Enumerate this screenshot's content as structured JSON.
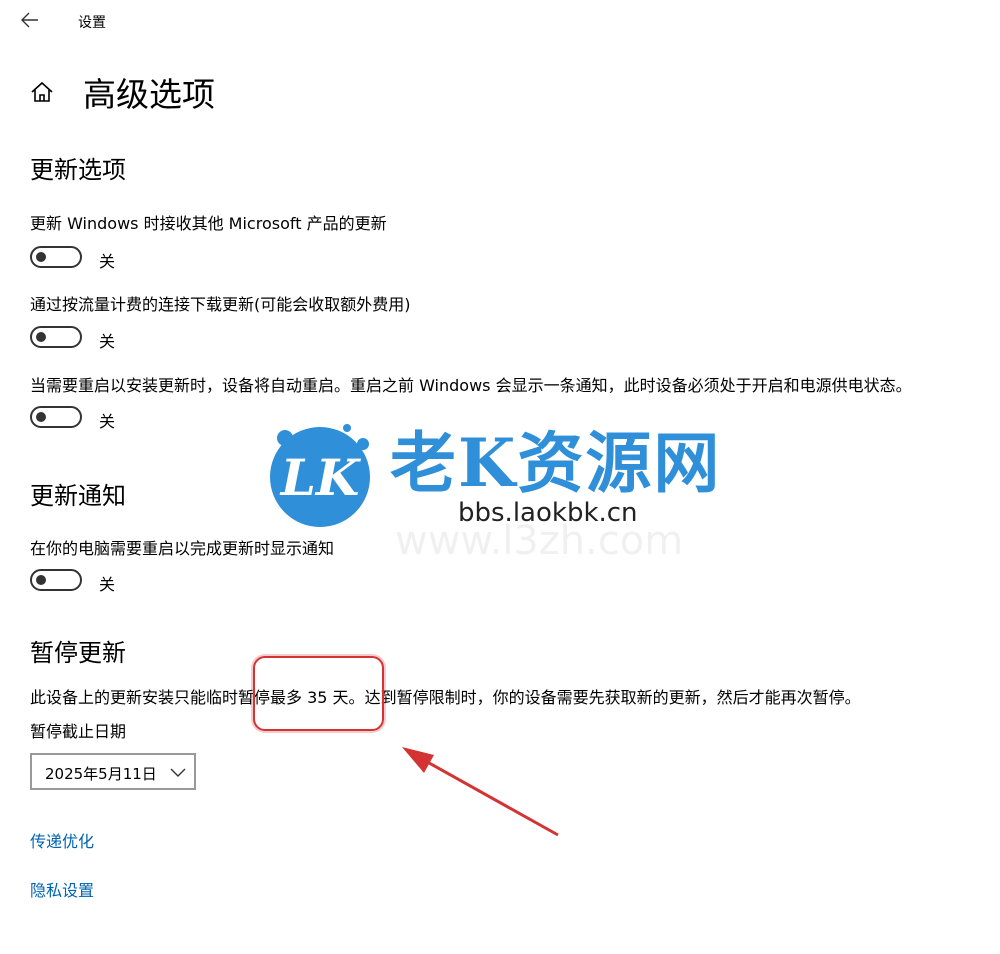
{
  "window": {
    "title": "设置"
  },
  "page": {
    "title": "高级选项"
  },
  "update_options": {
    "heading": "更新选项",
    "settings": [
      {
        "label": "更新 Windows 时接收其他 Microsoft 产品的更新",
        "state": "关"
      },
      {
        "label": "通过按流量计费的连接下载更新(可能会收取额外费用)",
        "state": "关"
      },
      {
        "label": "当需要重启以安装更新时，设备将自动重启。重启之前 Windows 会显示一条通知，此时设备必须处于开启和电源供电状态。",
        "state": "关"
      }
    ]
  },
  "update_notifications": {
    "heading": "更新通知",
    "settings": [
      {
        "label": "在你的电脑需要重启以完成更新时显示通知",
        "state": "关"
      }
    ]
  },
  "pause_updates": {
    "heading": "暂停更新",
    "description_before": "此设备上的更新安装只能临时",
    "description_highlight": "暂停最多 35 天。",
    "description_after": "达到暂停限制时，你的设备需要先获取新的更新，然后才能再次暂停。",
    "date_label": "暂停截止日期",
    "date_value": "2025年5月11日"
  },
  "links": {
    "delivery": "传递优化",
    "privacy": "隐私设置"
  },
  "watermark": {
    "logo": "LK",
    "brand": "老K资源网",
    "url": "bbs.laokbk.cn",
    "ghost": "www.l3zh.com"
  },
  "colors": {
    "accent": "#0063b1",
    "highlight": "#d43333",
    "watermark_blue": "#2f8fd8"
  },
  "icons": {
    "back": "arrow-left-icon",
    "home": "home-icon",
    "dropdown": "chevron-down-icon"
  }
}
